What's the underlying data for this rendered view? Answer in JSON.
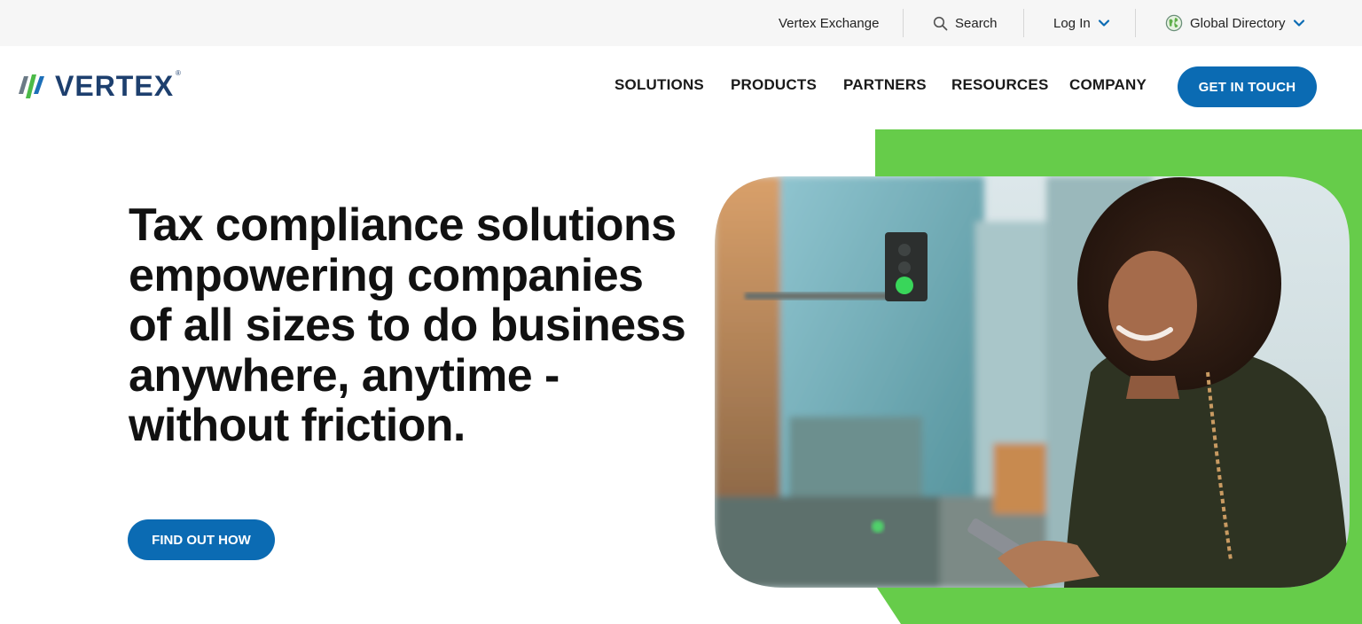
{
  "utility_bar": {
    "exchange_label": "Vertex Exchange",
    "search_label": "Search",
    "login_label": "Log In",
    "directory_label": "Global Directory"
  },
  "header": {
    "logo_text": "VERTEX",
    "logo_mark": "®",
    "nav": [
      "SOLUTIONS",
      "PRODUCTS",
      "PARTNERS",
      "RESOURCES",
      "COMPANY"
    ],
    "cta_label": "GET IN TOUCH"
  },
  "hero": {
    "headline": "Tax compliance solutions empowering companies of all sizes to do business anywhere, anytime - without friction.",
    "cta_label": "FIND OUT HOW",
    "image_alt": "Smiling woman with curly hair holding a phone on a city street"
  },
  "colors": {
    "brand_blue": "#0b6bb3",
    "brand_navy": "#1d3f6e",
    "accent_green": "#66cc4a",
    "utility_bg": "#f6f6f6"
  },
  "icons": {
    "search": "search-icon",
    "chevron": "chevron-down-icon",
    "globe": "globe-icon",
    "logo": "vertex-logo-icon"
  }
}
